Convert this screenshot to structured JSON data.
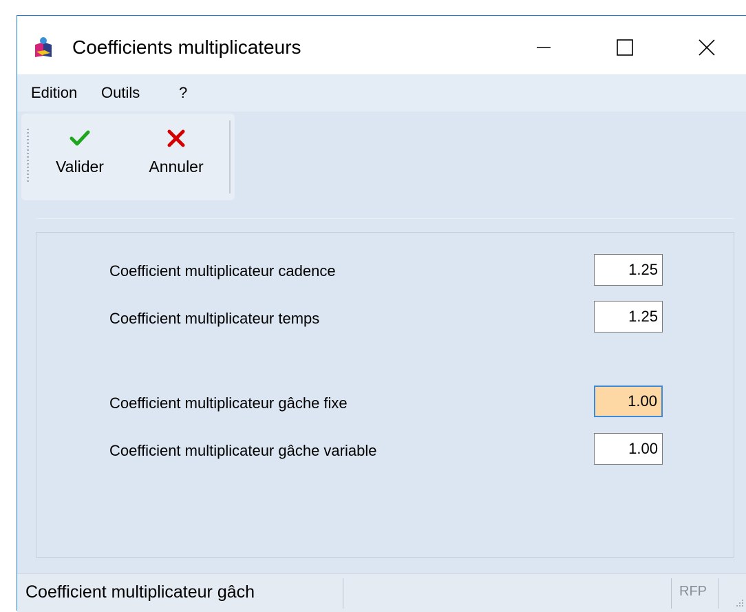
{
  "window": {
    "title": "Coefficients multiplicateurs",
    "controls": {
      "minimize": "minimize",
      "maximize": "maximize",
      "close": "close"
    }
  },
  "menu": {
    "items": [
      {
        "label": "Edition"
      },
      {
        "label": "Outils"
      },
      {
        "label": "?"
      }
    ]
  },
  "toolbar": {
    "validate_label": "Valider",
    "cancel_label": "Annuler",
    "validate_icon": "check-icon",
    "cancel_icon": "x-icon",
    "validate_color": "#1fa61f",
    "cancel_color": "#d40000"
  },
  "form": {
    "fields": [
      {
        "label": "Coefficient multiplicateur cadence",
        "value": "1.25"
      },
      {
        "label": "Coefficient multiplicateur temps",
        "value": "1.25"
      },
      {
        "label": "Coefficient multiplicateur gâche fixe",
        "value": "1.00",
        "focused": true
      },
      {
        "label": "Coefficient multiplicateur gâche variable",
        "value": "1.00"
      }
    ],
    "focus_color": "#fdd8a4"
  },
  "statusbar": {
    "message": "Coefficient multiplicateur gâch",
    "indicator": "RFP"
  }
}
